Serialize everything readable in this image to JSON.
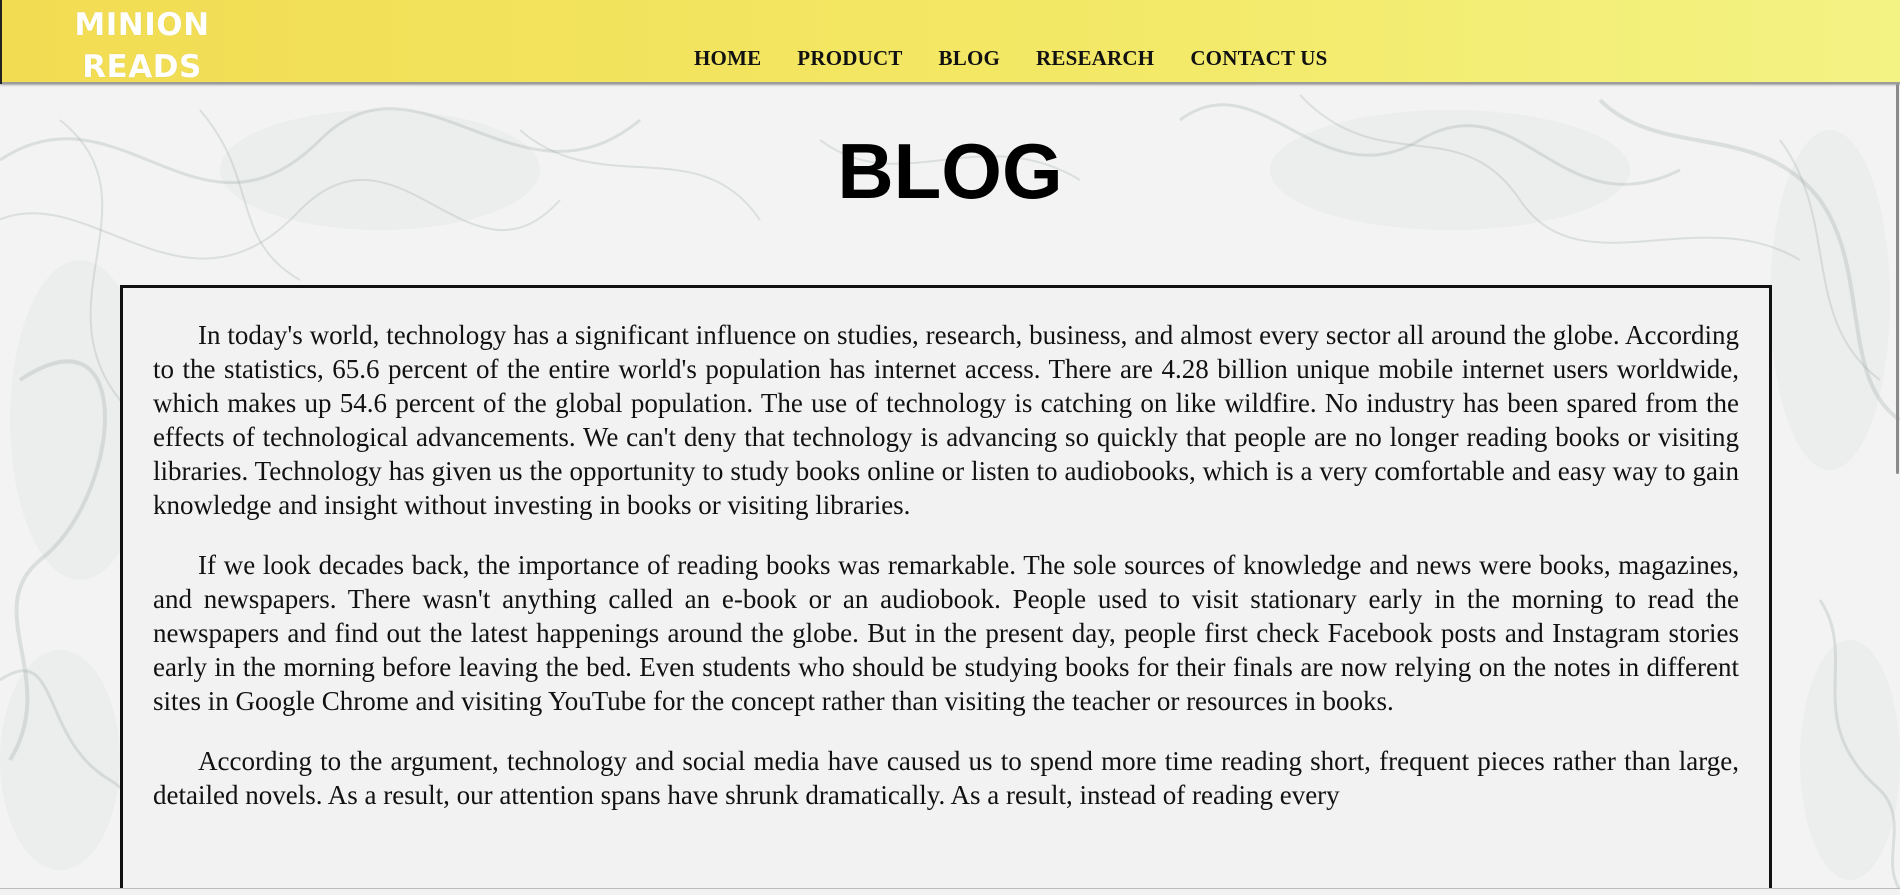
{
  "brand": {
    "logo_line1": "MINION",
    "logo_line2": "READS"
  },
  "nav": {
    "items": [
      {
        "label": "HOME"
      },
      {
        "label": "PRODUCT"
      },
      {
        "label": "BLOG"
      },
      {
        "label": "RESEARCH"
      },
      {
        "label": "CONTACT US"
      }
    ]
  },
  "page": {
    "title": "BLOG"
  },
  "article": {
    "paragraphs": [
      "In today's world, technology has a significant influence on studies, research, business, and almost every sector all around the globe. According to the statistics, 65.6 percent of the entire world's population has internet access. There are 4.28 billion unique mobile internet users worldwide, which makes up 54.6 percent of the global population. The use of technology is catching on like wildfire. No industry has been spared from the effects of technological advancements. We can't deny that technology is advancing so quickly that people are no longer reading books or visiting libraries. Technology has given us the opportunity to study books online or listen to audiobooks, which is a very comfortable and easy way to gain knowledge and insight without investing in books or visiting libraries.",
      "If we look decades back, the importance of reading books was remarkable. The sole sources of knowledge and news were books, magazines, and newspapers. There wasn't anything called an e-book or an audiobook. People used to visit stationary early in the morning to read the newspapers and find out the latest happenings around the globe. But in the present day, people first check Facebook posts and Instagram stories early in the morning before leaving the bed. Even students who should be studying books for their finals are now relying on the notes in different sites in Google Chrome and visiting YouTube for the concept rather than visiting the teacher or resources in books.",
      "According to the argument, technology and social media have caused us to spend more time reading short, frequent pieces rather than large, detailed novels. As a result, our attention spans have shrunk dramatically. As a result, instead of reading every"
    ]
  },
  "colors": {
    "header_start": "#f2dc52",
    "header_end": "#f3f384",
    "page_bg": "#f2f2f2",
    "text": "#111111",
    "logo_text": "#ffffff"
  }
}
